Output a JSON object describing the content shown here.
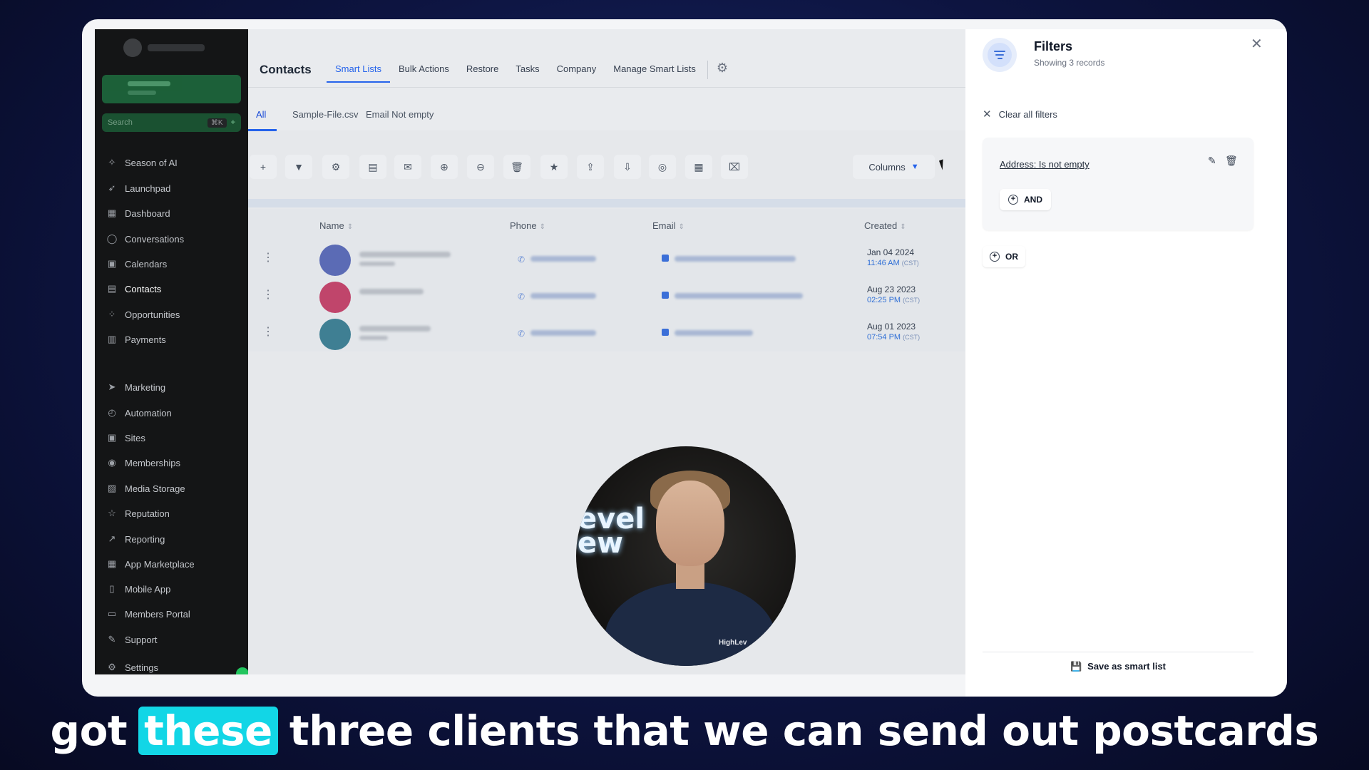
{
  "sidebar": {
    "search_placeholder": "Search",
    "search_shortcut": "⌘K",
    "items": [
      {
        "label": "Season of AI",
        "icon": "sparkle-icon"
      },
      {
        "label": "Launchpad",
        "icon": "rocket-icon"
      },
      {
        "label": "Dashboard",
        "icon": "dashboard-icon"
      },
      {
        "label": "Conversations",
        "icon": "chat-icon"
      },
      {
        "label": "Calendars",
        "icon": "calendar-icon"
      },
      {
        "label": "Contacts",
        "icon": "contacts-icon"
      },
      {
        "label": "Opportunities",
        "icon": "opportunities-icon"
      },
      {
        "label": "Payments",
        "icon": "payments-icon"
      },
      {
        "label": "Marketing",
        "icon": "send-icon"
      },
      {
        "label": "Automation",
        "icon": "automation-icon"
      },
      {
        "label": "Sites",
        "icon": "sites-icon"
      },
      {
        "label": "Memberships",
        "icon": "membership-icon"
      },
      {
        "label": "Media Storage",
        "icon": "media-icon"
      },
      {
        "label": "Reputation",
        "icon": "star-icon"
      },
      {
        "label": "Reporting",
        "icon": "reporting-icon"
      },
      {
        "label": "App Marketplace",
        "icon": "apps-icon"
      },
      {
        "label": "Mobile App",
        "icon": "mobile-icon"
      },
      {
        "label": "Members Portal",
        "icon": "portal-icon"
      },
      {
        "label": "Support",
        "icon": "wrench-icon"
      },
      {
        "label": "Settings",
        "icon": "gear-icon"
      }
    ]
  },
  "header": {
    "title": "Contacts",
    "tabs": [
      "Smart Lists",
      "Bulk Actions",
      "Restore",
      "Tasks",
      "Company",
      "Manage Smart Lists"
    ]
  },
  "subtabs": [
    "All",
    "Sample-File.csv",
    "Email Not empty"
  ],
  "toolbar": {
    "columns_label": "Columns"
  },
  "table": {
    "headers": [
      "Name",
      "Phone",
      "Email",
      "Created"
    ],
    "rows": [
      {
        "date": "Jan 04 2024",
        "time": "11:46 AM",
        "tz": "(CST)",
        "avatar_color": "#5b6bb5"
      },
      {
        "date": "Aug 23 2023",
        "time": "02:25 PM",
        "tz": "(CST)",
        "avatar_color": "#c0456b"
      },
      {
        "date": "Aug 01 2023",
        "time": "07:54 PM",
        "tz": "(CST)",
        "avatar_color": "#3f7f93"
      }
    ]
  },
  "filters": {
    "title": "Filters",
    "subtitle": "Showing 3 records",
    "clear_label": "Clear all filters",
    "condition": "Address: Is not empty",
    "and_label": "AND",
    "or_label": "OR",
    "save_label": "Save as smart list"
  },
  "webcam": {
    "neon_text": "evel\new",
    "badge": "HighLev"
  },
  "caption": {
    "before": "got",
    "highlight": "these",
    "after": "three clients that we can send out postcards"
  }
}
